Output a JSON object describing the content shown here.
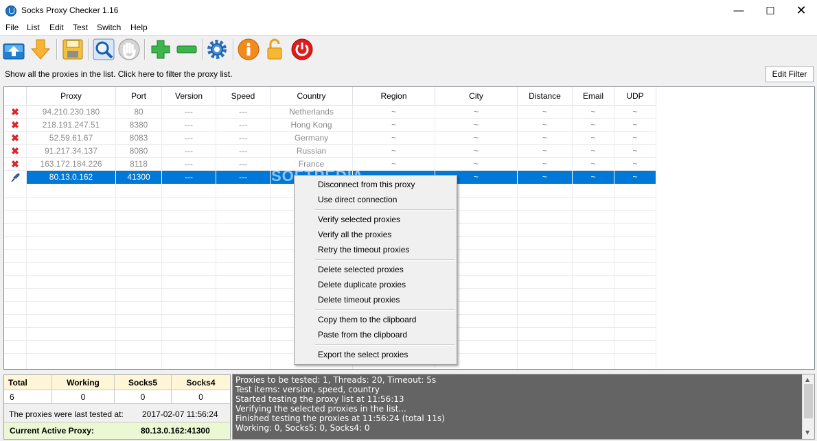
{
  "window": {
    "title": "Socks Proxy Checker 1.16"
  },
  "menu": [
    "File",
    "List",
    "Edit",
    "Test",
    "Switch",
    "Help"
  ],
  "toolbar_icons": [
    "import-icon",
    "download-icon",
    "save-icon",
    "search-icon",
    "stop-hand-icon",
    "add-icon",
    "remove-icon",
    "settings-gear-icon",
    "info-icon",
    "unlock-icon",
    "power-icon"
  ],
  "filter": {
    "text": "Show all the proxies in the list. Click here to filter the proxy list.",
    "button": "Edit Filter"
  },
  "table": {
    "columns": [
      "Proxy",
      "Port",
      "Version",
      "Speed",
      "Country",
      "Region",
      "City",
      "Distance",
      "Email",
      "UDP"
    ],
    "rows": [
      {
        "status": "x",
        "proxy": "94.210.230.180",
        "port": "80",
        "version": "---",
        "speed": "---",
        "country": "Netherlands",
        "region": "~",
        "city": "~",
        "distance": "~",
        "email": "~",
        "udp": "~"
      },
      {
        "status": "x",
        "proxy": "218.191.247.51",
        "port": "8380",
        "version": "---",
        "speed": "---",
        "country": "Hong Kong",
        "region": "~",
        "city": "~",
        "distance": "~",
        "email": "~",
        "udp": "~"
      },
      {
        "status": "x",
        "proxy": "52.59.61.67",
        "port": "8083",
        "version": "---",
        "speed": "---",
        "country": "Germany",
        "region": "~",
        "city": "~",
        "distance": "~",
        "email": "~",
        "udp": "~"
      },
      {
        "status": "x",
        "proxy": "91.217.34.137",
        "port": "8080",
        "version": "---",
        "speed": "---",
        "country": "Russian",
        "region": "~",
        "city": "~",
        "distance": "~",
        "email": "~",
        "udp": "~"
      },
      {
        "status": "x",
        "proxy": "163.172.184.226",
        "port": "8118",
        "version": "---",
        "speed": "---",
        "country": "France",
        "region": "~",
        "city": "~",
        "distance": "~",
        "email": "~",
        "udp": "~"
      },
      {
        "status": "active",
        "proxy": "80.13.0.162",
        "port": "41300",
        "version": "---",
        "speed": "---",
        "country": "",
        "region": "~",
        "city": "~",
        "distance": "~",
        "email": "~",
        "udp": "~"
      }
    ]
  },
  "context_menu": [
    [
      "Disconnect from this proxy",
      "Use direct connection"
    ],
    [
      "Verify selected proxies",
      "Verify all the proxies",
      "Retry the timeout proxies"
    ],
    [
      "Delete selected proxies",
      "Delete duplicate proxies",
      "Delete timeout proxies"
    ],
    [
      "Copy them to the clipboard",
      "Paste from the clipboard"
    ],
    [
      "Export the select proxies"
    ]
  ],
  "stats": {
    "headers": [
      "Total",
      "Working",
      "Socks5",
      "Socks4"
    ],
    "values": [
      "6",
      "0",
      "0",
      "0"
    ],
    "last_tested_label": "The proxies were last tested at:",
    "last_tested_value": "2017-02-07 11:56:24",
    "active_label": "Current Active Proxy:",
    "active_value": "80.13.0.162:41300"
  },
  "log": [
    "Proxies to be tested: 1, Threads: 20, Timeout: 5s",
    "Test items: version, speed, country",
    "Started testing the proxy list at 11:56:13",
    "Verifying the selected proxies in the list...",
    "Finished testing the proxies at 11:56:24 (total 11s)",
    "Working: 0, Socks5: 0, Socks4: 0"
  ],
  "watermark": "SOFTPEDIA"
}
